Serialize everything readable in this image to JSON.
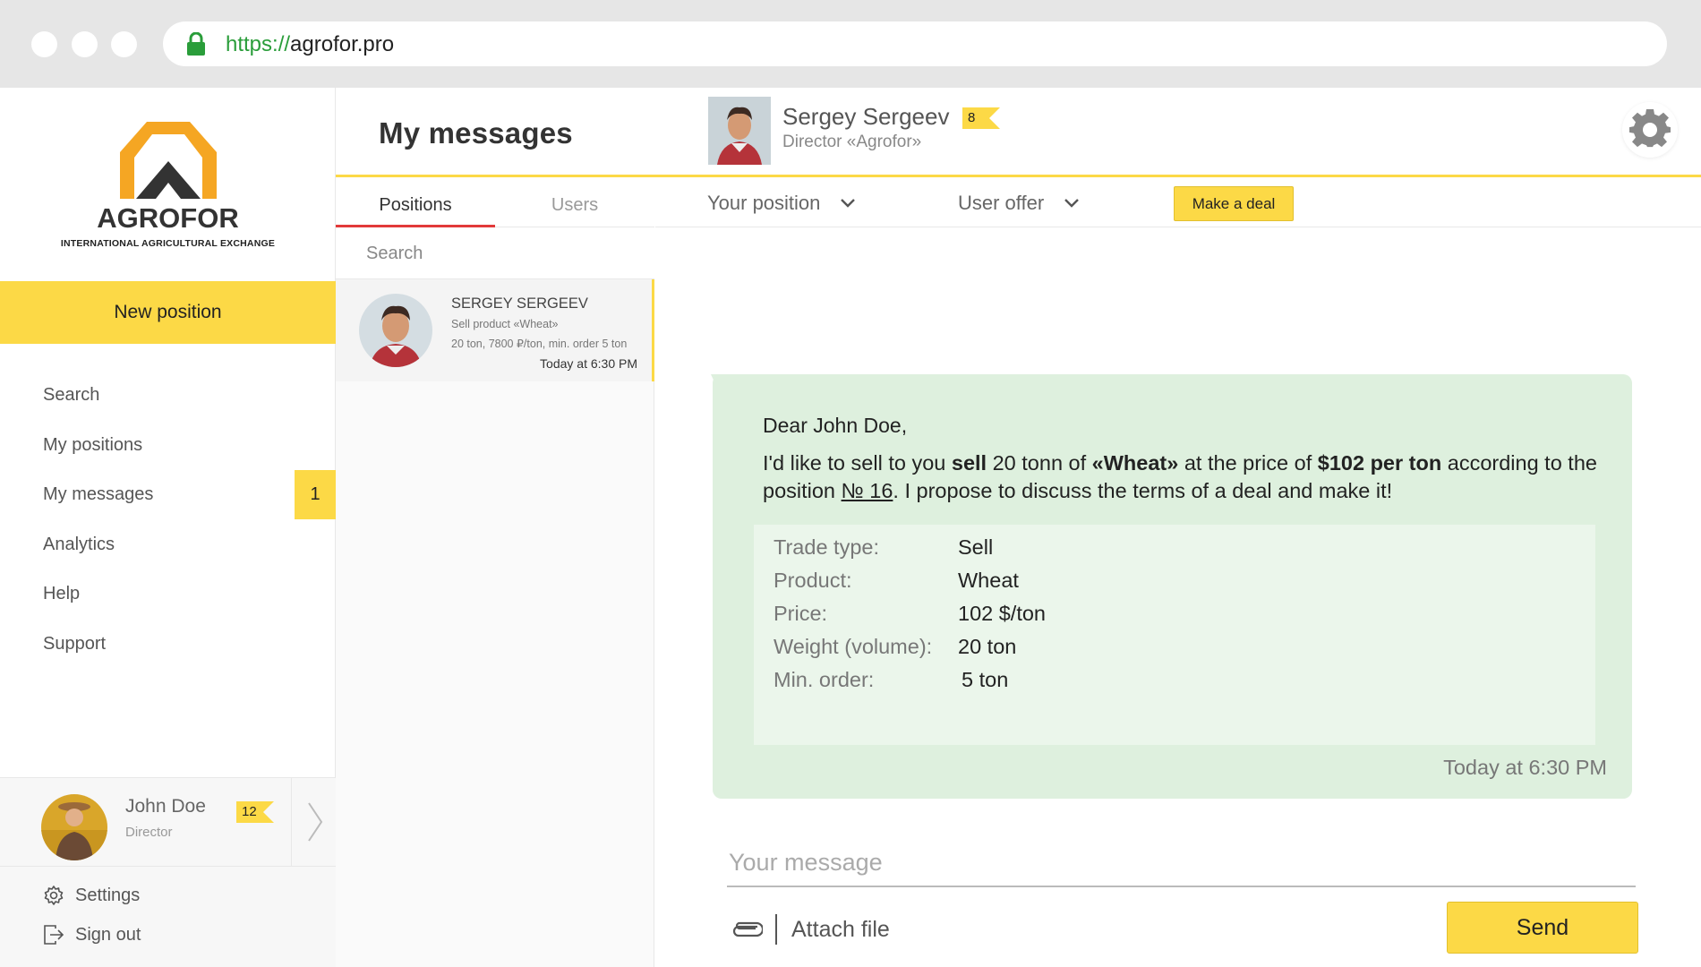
{
  "browser": {
    "url_protocol": "https://",
    "url_domain": "agrofor.pro"
  },
  "sidebar": {
    "logo_text": "AGROFOR",
    "logo_subtitle": "INTERNATIONAL AGRICULTURAL EXCHANGE",
    "new_position_label": "New position",
    "items": [
      {
        "label": "Search",
        "badge": null
      },
      {
        "label": "My positions",
        "badge": null
      },
      {
        "label": "My messages",
        "badge": "1"
      },
      {
        "label": "Analytics",
        "badge": null
      },
      {
        "label": "Help",
        "badge": null
      },
      {
        "label": "Support",
        "badge": null
      }
    ],
    "user": {
      "name": "John Doe",
      "role": "Director",
      "badge": "12"
    },
    "settings_label": "Settings",
    "signout_label": "Sign out"
  },
  "header": {
    "title": "My messages",
    "contact": {
      "name": "Sergey Sergeev",
      "role": "Director «Agrofor»",
      "badge": "8"
    }
  },
  "list": {
    "tabs": [
      {
        "label": "Positions",
        "active": true
      },
      {
        "label": "Users",
        "active": false
      }
    ],
    "search_placeholder": "Search",
    "conversations": [
      {
        "name": "SERGEY SERGEEV",
        "line1": "Sell product «Wheat»",
        "line2": "20 ton, 7800 ₽/ton, min. order 5 ton",
        "time": "Today at 6:30 PM"
      }
    ]
  },
  "chat": {
    "your_position_label": "Your position",
    "user_offer_label": "User offer",
    "make_deal_label": "Make a deal",
    "message": {
      "greeting": "Dear John Doe,",
      "p1": "I'd like to sell to you ",
      "p1_bold": "sell",
      "p2": " 20 tonn of ",
      "p2_bold": "«Wheat»",
      "p3": " at the price of ",
      "p3_bold": "$102 per ton",
      "p4": " according to the position ",
      "p4_link": "№ 16",
      "p5": ". I propose to discuss the terms of a deal and make it!",
      "details": [
        {
          "label": "Trade type:",
          "value": "Sell"
        },
        {
          "label": "Product:",
          "value": "Wheat"
        },
        {
          "label": "Price:",
          "value": "102 $/ton"
        },
        {
          "label": "Weight (volume):",
          "value": "20 ton"
        },
        {
          "label": "Min. order:",
          "value": "5 ton"
        }
      ],
      "time": "Today at 6:30 PM"
    },
    "input_placeholder": "Your message",
    "attach_label": "Attach file",
    "send_label": "Send"
  },
  "colors": {
    "accent": "#fcd946",
    "bubble": "#def0de",
    "active_tab": "#e23a3a",
    "secure": "#2a9d3a"
  }
}
